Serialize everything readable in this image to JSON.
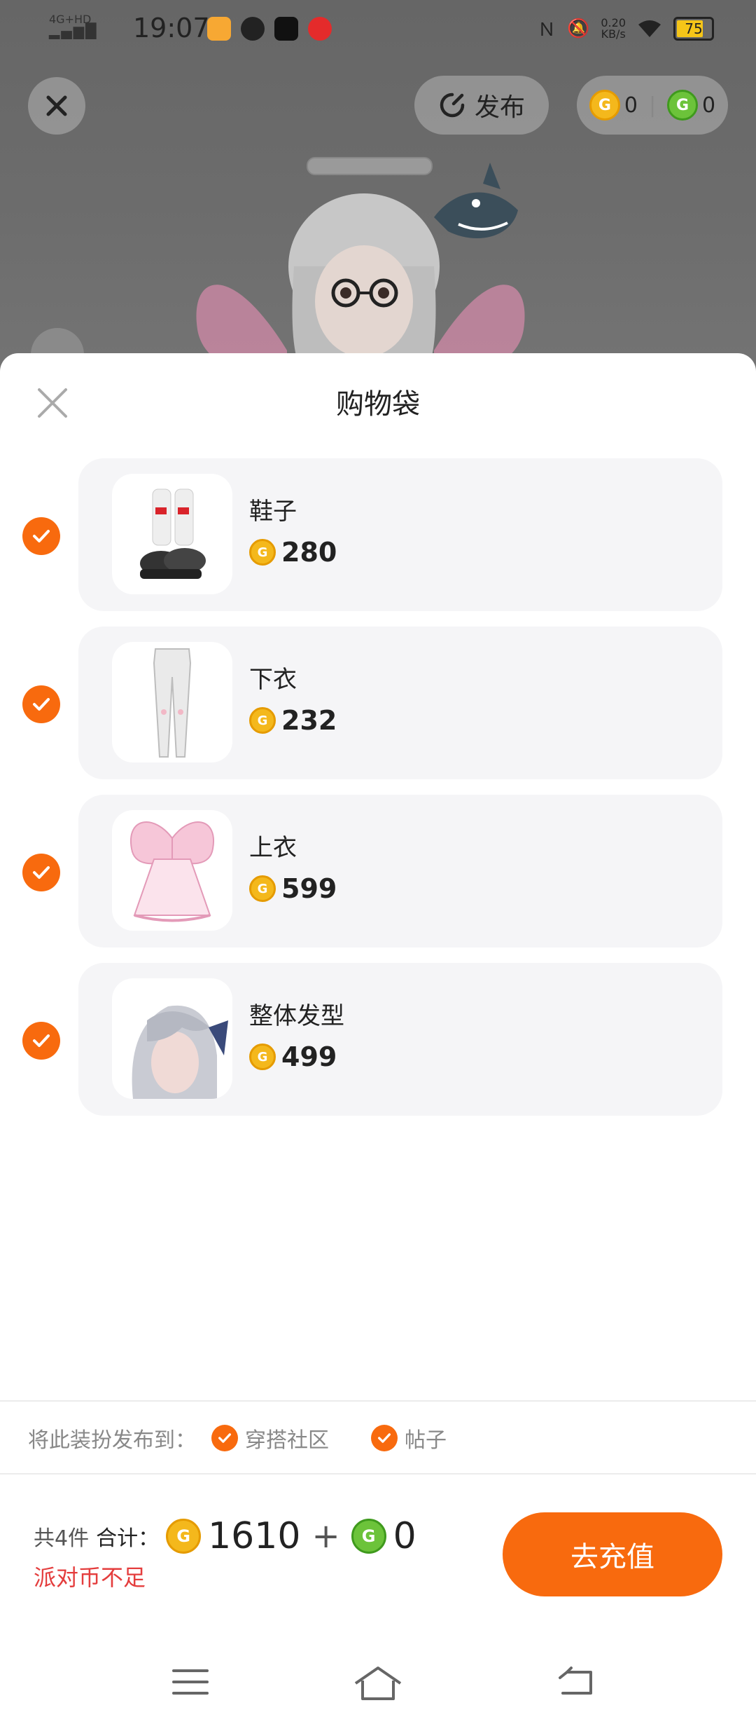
{
  "status_bar": {
    "network": "4G+HD",
    "time": "19:07",
    "speed_value": "0.20",
    "speed_unit": "KB/s",
    "battery": "75"
  },
  "header": {
    "close_icon": "close-icon",
    "publish_label": "发布",
    "gold_balance": "0",
    "green_balance": "0"
  },
  "sheet": {
    "title": "购物袋",
    "items": [
      {
        "name": "鞋子",
        "price": "280",
        "checked": true
      },
      {
        "name": "下衣",
        "price": "232",
        "checked": true
      },
      {
        "name": "上衣",
        "price": "599",
        "checked": true
      },
      {
        "name": "整体发型",
        "price": "499",
        "checked": true
      }
    ]
  },
  "publish_to": {
    "label": "将此装扮发布到：",
    "options": [
      {
        "label": "穿搭社区",
        "checked": true
      },
      {
        "label": "帖子",
        "checked": true
      }
    ]
  },
  "footer": {
    "count": "共4件",
    "total_label": "合计：",
    "gold_total": "1610",
    "plus": "+",
    "green_total": "0",
    "warning": "派对币不足",
    "recharge_button": "去充值"
  },
  "colors": {
    "accent": "#f86a0e",
    "warning": "#e43d3d",
    "gold_coin": "#f4b81c",
    "green_coin": "#6cc33a"
  }
}
